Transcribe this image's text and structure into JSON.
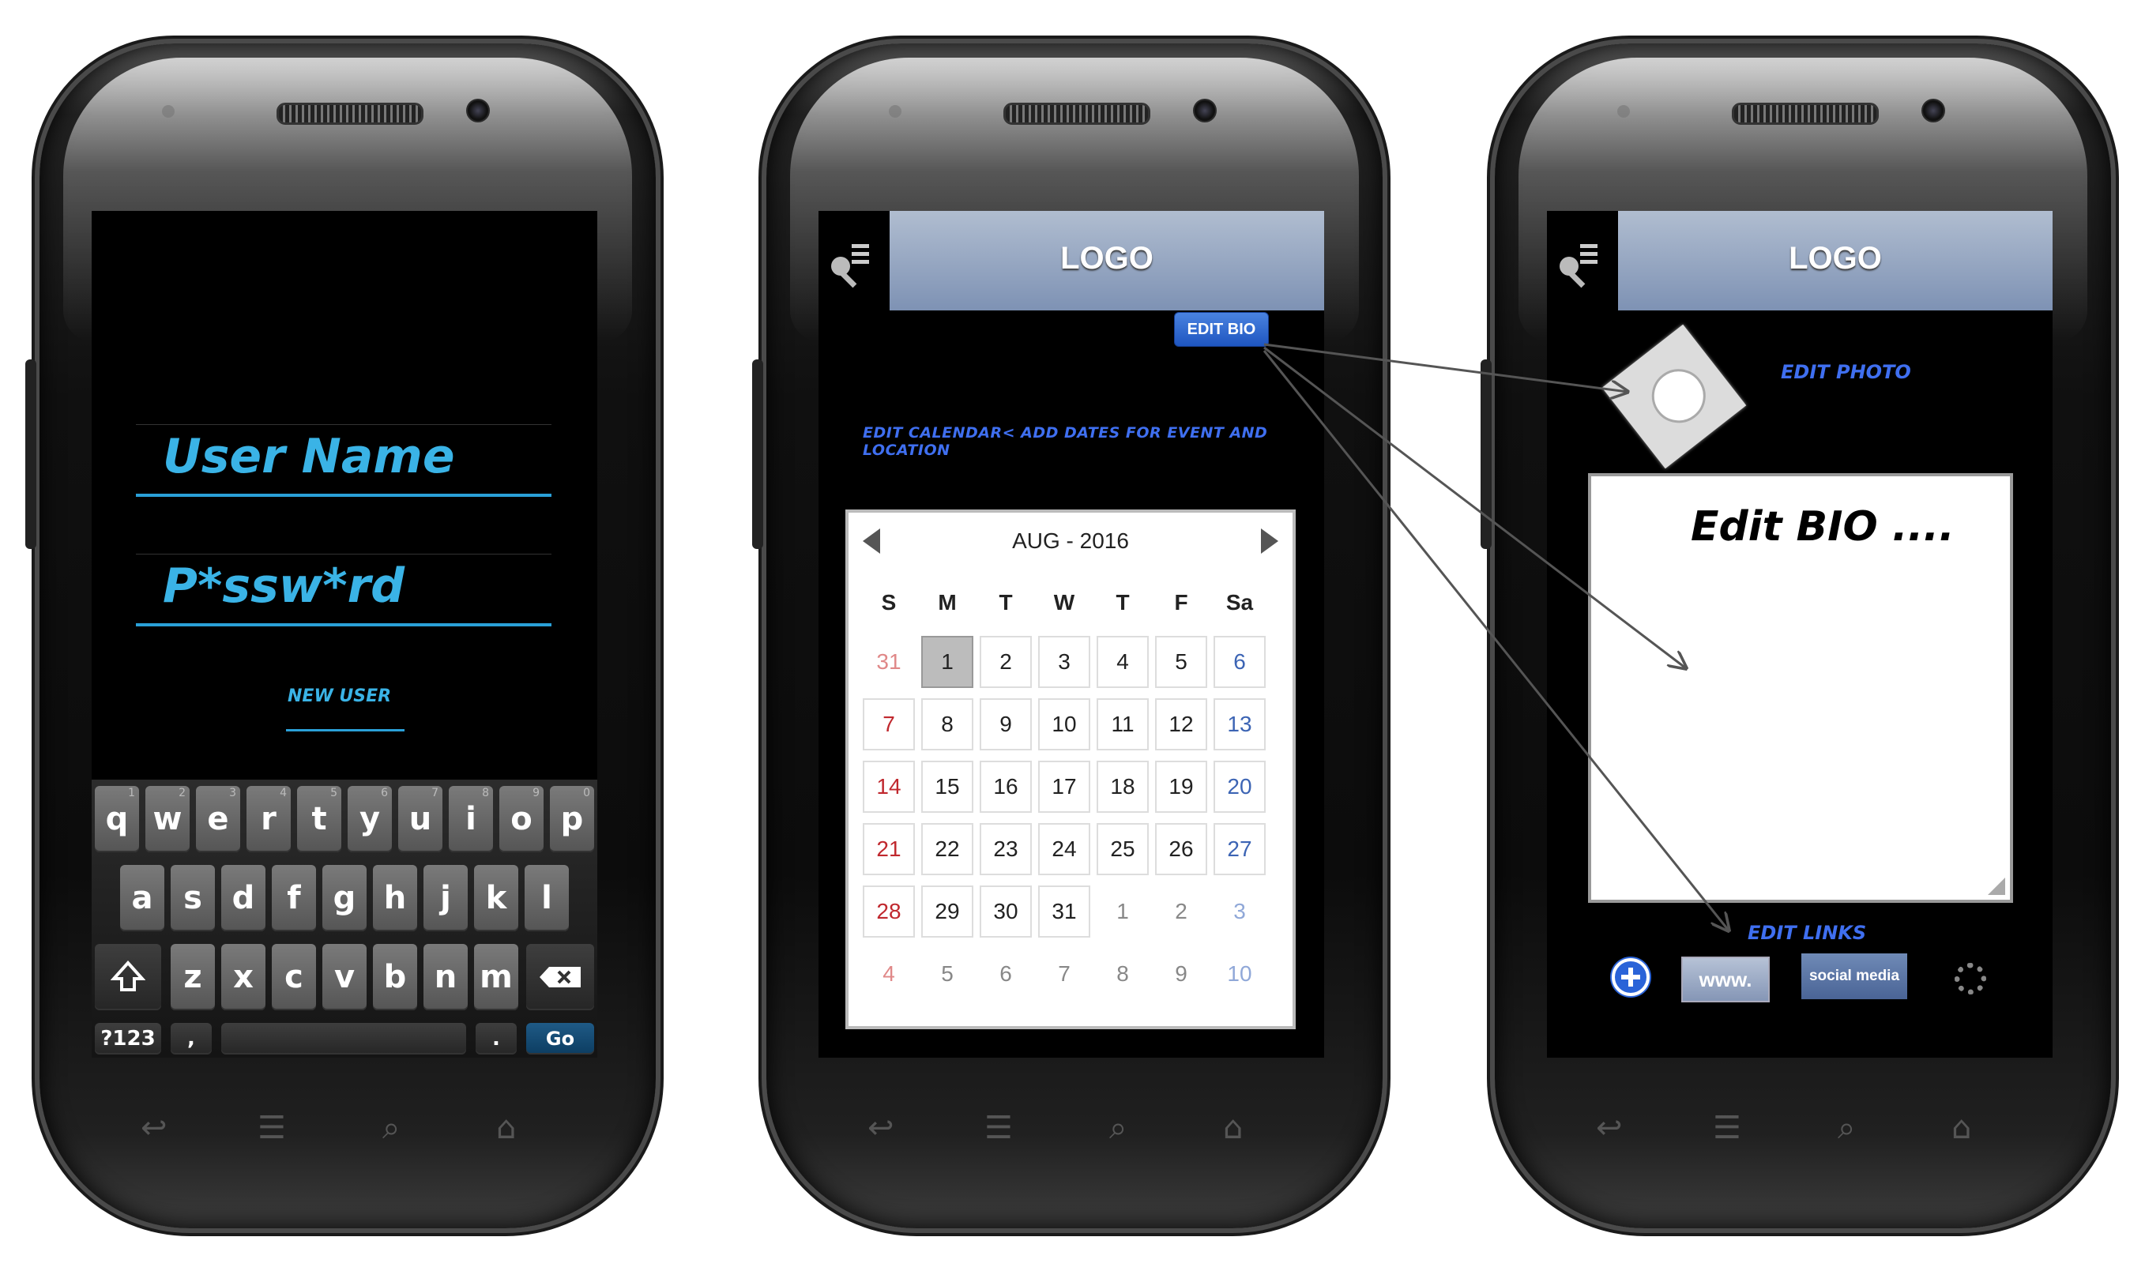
{
  "login": {
    "username_placeholder": "User Name",
    "password_placeholder": "P*ssw*rd",
    "new_user_label": "NEW USER"
  },
  "keyboard": {
    "row1": [
      {
        "key": "q",
        "hint": "1"
      },
      {
        "key": "w",
        "hint": "2"
      },
      {
        "key": "e",
        "hint": "3"
      },
      {
        "key": "r",
        "hint": "4"
      },
      {
        "key": "t",
        "hint": "5"
      },
      {
        "key": "y",
        "hint": "6"
      },
      {
        "key": "u",
        "hint": "7"
      },
      {
        "key": "i",
        "hint": "8"
      },
      {
        "key": "o",
        "hint": "9"
      },
      {
        "key": "p",
        "hint": "0"
      }
    ],
    "row2": [
      "a",
      "s",
      "d",
      "f",
      "g",
      "h",
      "j",
      "k",
      "l"
    ],
    "row3": [
      "z",
      "x",
      "c",
      "v",
      "b",
      "n",
      "m"
    ],
    "shift_icon": "shift-arrow-icon",
    "backspace_icon": "backspace-icon",
    "symbols_label": "?123",
    "comma_label": ",",
    "period_label": ".",
    "go_label": "Go"
  },
  "header": {
    "logo": "LOGO",
    "menu_icon": "key-menu-icon"
  },
  "calendar_screen": {
    "edit_bio_button": "EDIT BIO",
    "edit_calendar_label": "EDIT CALENDAR< ADD DATES FOR EVENT AND LOCATION",
    "month_label": "AUG - 2016",
    "weekdays": [
      "S",
      "M",
      "T",
      "W",
      "T",
      "F",
      "Sa"
    ],
    "weeks": [
      [
        "31",
        "1",
        "2",
        "3",
        "4",
        "5",
        "6"
      ],
      [
        "7",
        "8",
        "9",
        "10",
        "11",
        "12",
        "13"
      ],
      [
        "14",
        "15",
        "16",
        "17",
        "18",
        "19",
        "20"
      ],
      [
        "21",
        "22",
        "23",
        "24",
        "25",
        "26",
        "27"
      ],
      [
        "28",
        "29",
        "30",
        "31",
        "1",
        "2",
        "3"
      ],
      [
        "4",
        "5",
        "6",
        "7",
        "8",
        "9",
        "10"
      ]
    ],
    "selected_day": "1",
    "colors": {
      "sunday": "#c0282e",
      "saturday": "#3c64b4",
      "muted_sunday": "#e08888",
      "muted_saturday": "#90a8d8"
    }
  },
  "bio_screen": {
    "edit_photo_label": "EDIT PHOTO",
    "bio_text": "Edit BIO  ....",
    "edit_links_label": "EDIT LINKS",
    "www_button": "www.",
    "social_button": "social media",
    "add_icon": "plus-circle-icon",
    "loading_icon": "spinner-icon"
  },
  "soft_keys": [
    "back-icon",
    "menu-lines-icon",
    "search-icon",
    "home-icon"
  ]
}
